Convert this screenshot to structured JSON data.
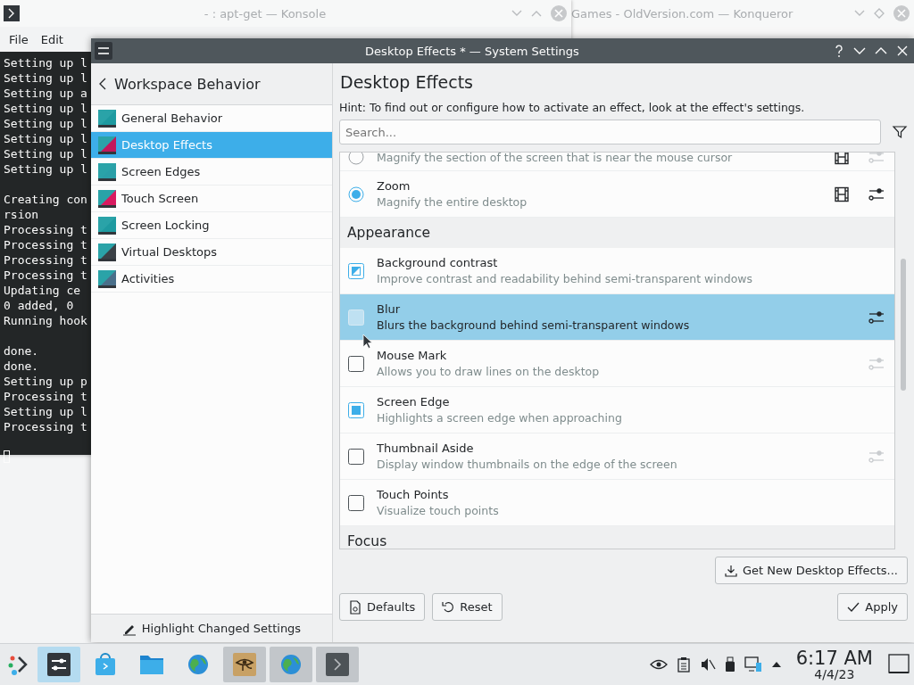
{
  "background_windows": [
    {
      "kind": "konsole",
      "title": "- : apt-get — Konsole",
      "menu": [
        "File",
        "Edit"
      ],
      "terminal_blocks": [
        [
          "Setting up l",
          "Setting up l",
          "Setting up a",
          "Setting up l",
          "Setting up l",
          "Setting up l",
          "Setting up l",
          "Setting up l"
        ],
        [
          "Creating con",
          "rsion",
          "Processing t",
          "Processing t",
          "Processing t",
          "Processing t",
          "Updating ce",
          "0 added, 0",
          "Running hook"
        ],
        [
          "done.",
          "done.",
          "Setting up p",
          "Processing t",
          "Setting up l",
          "Processing t"
        ]
      ]
    },
    {
      "kind": "browser",
      "title": "Games - OldVersion.com — Konqueror"
    }
  ],
  "window": {
    "title": "Desktop Effects * — System Settings"
  },
  "sidebar": {
    "back_title": "Workspace Behavior",
    "items": [
      {
        "label": "General Behavior",
        "selected": false
      },
      {
        "label": "Desktop Effects",
        "selected": true
      },
      {
        "label": "Screen Edges",
        "selected": false
      },
      {
        "label": "Touch Screen",
        "selected": false
      },
      {
        "label": "Screen Locking",
        "selected": false
      },
      {
        "label": "Virtual Desktops",
        "selected": false
      },
      {
        "label": "Activities",
        "selected": false
      }
    ],
    "highlight_button": "Highlight Changed Settings"
  },
  "page": {
    "title": "Desktop Effects",
    "hint": "Hint: To find out or configure how to activate an effect, look at the effect's settings.",
    "search": {
      "placeholder": "Search..."
    },
    "sections": [
      {
        "items": [
          {
            "kind": "radio",
            "description": "Magnify the section of the screen that is near the mouse cursor",
            "checked": false,
            "selected": false,
            "video": true,
            "configurable": true,
            "configure_enabled": false
          },
          {
            "kind": "radio",
            "title": "Zoom",
            "description": "Magnify the entire desktop",
            "checked": true,
            "selected": false,
            "video": true,
            "configurable": true,
            "configure_enabled": true
          }
        ]
      },
      {
        "header": "Appearance",
        "items": [
          {
            "kind": "checkbox",
            "title": "Background contrast",
            "description": "Improve contrast and readability behind semi-transparent windows",
            "checked": true,
            "partial": true,
            "selected": false,
            "video": false,
            "configurable": false
          },
          {
            "kind": "checkbox",
            "title": "Blur",
            "description": "Blurs the background behind semi-transparent windows",
            "checked": false,
            "partial": false,
            "selected": true,
            "video": false,
            "configurable": true,
            "configure_enabled": true
          },
          {
            "kind": "checkbox",
            "title": "Mouse Mark",
            "description": "Allows you to draw lines on the desktop",
            "checked": false,
            "partial": false,
            "selected": false,
            "video": false,
            "configurable": true,
            "configure_enabled": false
          },
          {
            "kind": "checkbox",
            "title": "Screen Edge",
            "description": "Highlights a screen edge when approaching",
            "checked": true,
            "partial": false,
            "selected": false,
            "video": false,
            "configurable": false
          },
          {
            "kind": "checkbox",
            "title": "Thumbnail Aside",
            "description": "Display window thumbnails on the edge of the screen",
            "checked": false,
            "partial": false,
            "selected": false,
            "video": false,
            "configurable": true,
            "configure_enabled": false
          },
          {
            "kind": "checkbox",
            "title": "Touch Points",
            "description": "Visualize touch points",
            "checked": false,
            "partial": false,
            "selected": false,
            "video": false,
            "configurable": false
          }
        ]
      },
      {
        "header": "Focus"
      }
    ],
    "get_new_button": "Get New Desktop Effects...",
    "buttons": [
      {
        "kind": "defaults",
        "label": "Defaults"
      },
      {
        "kind": "reset",
        "label": "Reset"
      },
      {
        "kind": "apply",
        "label": "Apply"
      }
    ]
  },
  "taskbar": {
    "tasks": [
      {
        "kind": "settings",
        "selected": true,
        "running": true
      },
      {
        "kind": "store",
        "selected": false,
        "running": false
      },
      {
        "kind": "files",
        "selected": false,
        "running": false
      },
      {
        "kind": "globe",
        "selected": false,
        "running": false
      },
      {
        "kind": "eye-app",
        "selected": false,
        "running": true
      },
      {
        "kind": "globe",
        "selected": false,
        "running": true
      },
      {
        "kind": "terminal",
        "selected": false,
        "running": true
      }
    ],
    "time": "6:17 AM",
    "date": "4/4/23"
  }
}
